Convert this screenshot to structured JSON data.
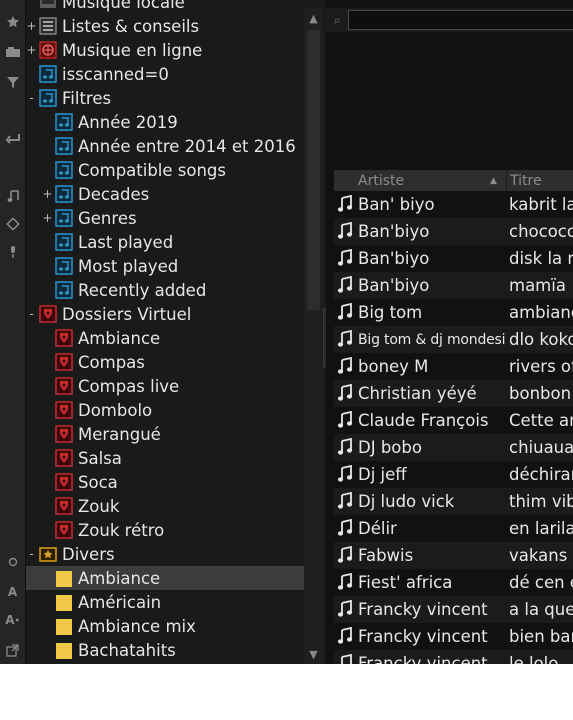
{
  "tree": [
    {
      "label": "Musique locale",
      "toggle": "",
      "icon": "local",
      "depth": 0
    },
    {
      "label": "Listes & conseils",
      "toggle": "+",
      "icon": "list",
      "depth": 0
    },
    {
      "label": "Musique en ligne",
      "toggle": "+",
      "icon": "online",
      "depth": 0
    },
    {
      "label": "isscanned=0",
      "toggle": "",
      "icon": "filter",
      "depth": 0
    },
    {
      "label": "Filtres",
      "toggle": "-",
      "icon": "filter",
      "depth": 0
    },
    {
      "label": "Année 2019",
      "toggle": "",
      "icon": "filter",
      "depth": 1
    },
    {
      "label": "Année entre 2014 et 2016",
      "toggle": "",
      "icon": "filter",
      "depth": 1
    },
    {
      "label": "Compatible songs",
      "toggle": "",
      "icon": "filter",
      "depth": 1
    },
    {
      "label": "Decades",
      "toggle": "+",
      "icon": "filter",
      "depth": 1
    },
    {
      "label": "Genres",
      "toggle": "+",
      "icon": "filter",
      "depth": 1
    },
    {
      "label": "Last played",
      "toggle": "",
      "icon": "filter",
      "depth": 1
    },
    {
      "label": "Most played",
      "toggle": "",
      "icon": "filter",
      "depth": 1
    },
    {
      "label": "Recently added",
      "toggle": "",
      "icon": "filter",
      "depth": 1
    },
    {
      "label": "Dossiers Virtuel",
      "toggle": "-",
      "icon": "virtual",
      "depth": 0
    },
    {
      "label": "Ambiance",
      "toggle": "",
      "icon": "virtual",
      "depth": 1
    },
    {
      "label": "Compas",
      "toggle": "",
      "icon": "virtual",
      "depth": 1
    },
    {
      "label": "Compas live",
      "toggle": "",
      "icon": "virtual",
      "depth": 1
    },
    {
      "label": "Dombolo",
      "toggle": "",
      "icon": "virtual",
      "depth": 1
    },
    {
      "label": "Merangué",
      "toggle": "",
      "icon": "virtual",
      "depth": 1
    },
    {
      "label": "Salsa",
      "toggle": "",
      "icon": "virtual",
      "depth": 1
    },
    {
      "label": "Soca",
      "toggle": "",
      "icon": "virtual",
      "depth": 1
    },
    {
      "label": "Zouk",
      "toggle": "",
      "icon": "virtual",
      "depth": 1
    },
    {
      "label": "Zouk rétro",
      "toggle": "",
      "icon": "virtual",
      "depth": 1
    },
    {
      "label": "Divers",
      "toggle": "-",
      "icon": "star",
      "depth": 0
    },
    {
      "label": "Ambiance",
      "toggle": "",
      "icon": "folder",
      "depth": 1,
      "selected": true
    },
    {
      "label": "Américain",
      "toggle": "",
      "icon": "folder",
      "depth": 1
    },
    {
      "label": "Ambiance mix",
      "toggle": "",
      "icon": "folder",
      "depth": 1
    },
    {
      "label": "Bachatahits",
      "toggle": "",
      "icon": "folder",
      "depth": 1
    }
  ],
  "side_tab": "folders",
  "columns": {
    "artist": "Artiste",
    "title": "Titre",
    "sort_indicator": "▲"
  },
  "tracks": [
    {
      "artist": "Ban' biyo",
      "title": "kabrit la"
    },
    {
      "artist": "Ban'biyo",
      "title": "chococo"
    },
    {
      "artist": "Ban'biyo",
      "title": "disk la r"
    },
    {
      "artist": "Ban'biyo",
      "title": "mamïa"
    },
    {
      "artist": "Big tom",
      "title": "ambianc"
    },
    {
      "artist": "Big tom & dj mondesir",
      "title": "dlo koko",
      "narrow": true
    },
    {
      "artist": "boney M",
      "title": "rivers of"
    },
    {
      "artist": "Christian yéyé",
      "title": "bonbon"
    },
    {
      "artist": "Claude François",
      "title": "Cette an"
    },
    {
      "artist": "DJ bobo",
      "title": "chiuaua"
    },
    {
      "artist": "Dj jeff",
      "title": "déchiran"
    },
    {
      "artist": "Dj ludo vick",
      "title": "thim vibe"
    },
    {
      "artist": "Délir",
      "title": "en larila"
    },
    {
      "artist": "Fabwis",
      "title": "vakans"
    },
    {
      "artist": "Fiest' africa",
      "title": "dé cen e"
    },
    {
      "artist": "Francky vincent",
      "title": "a la que"
    },
    {
      "artist": "Francky vincent",
      "title": "bien bar"
    },
    {
      "artist": "Francky vincent",
      "title": "le lolo"
    }
  ],
  "colors": {
    "filter": "#2d95c9",
    "virtual": "#c92a2a",
    "folder": "#f2c84b",
    "star": "#e0a020",
    "online": "#d42b2b"
  }
}
